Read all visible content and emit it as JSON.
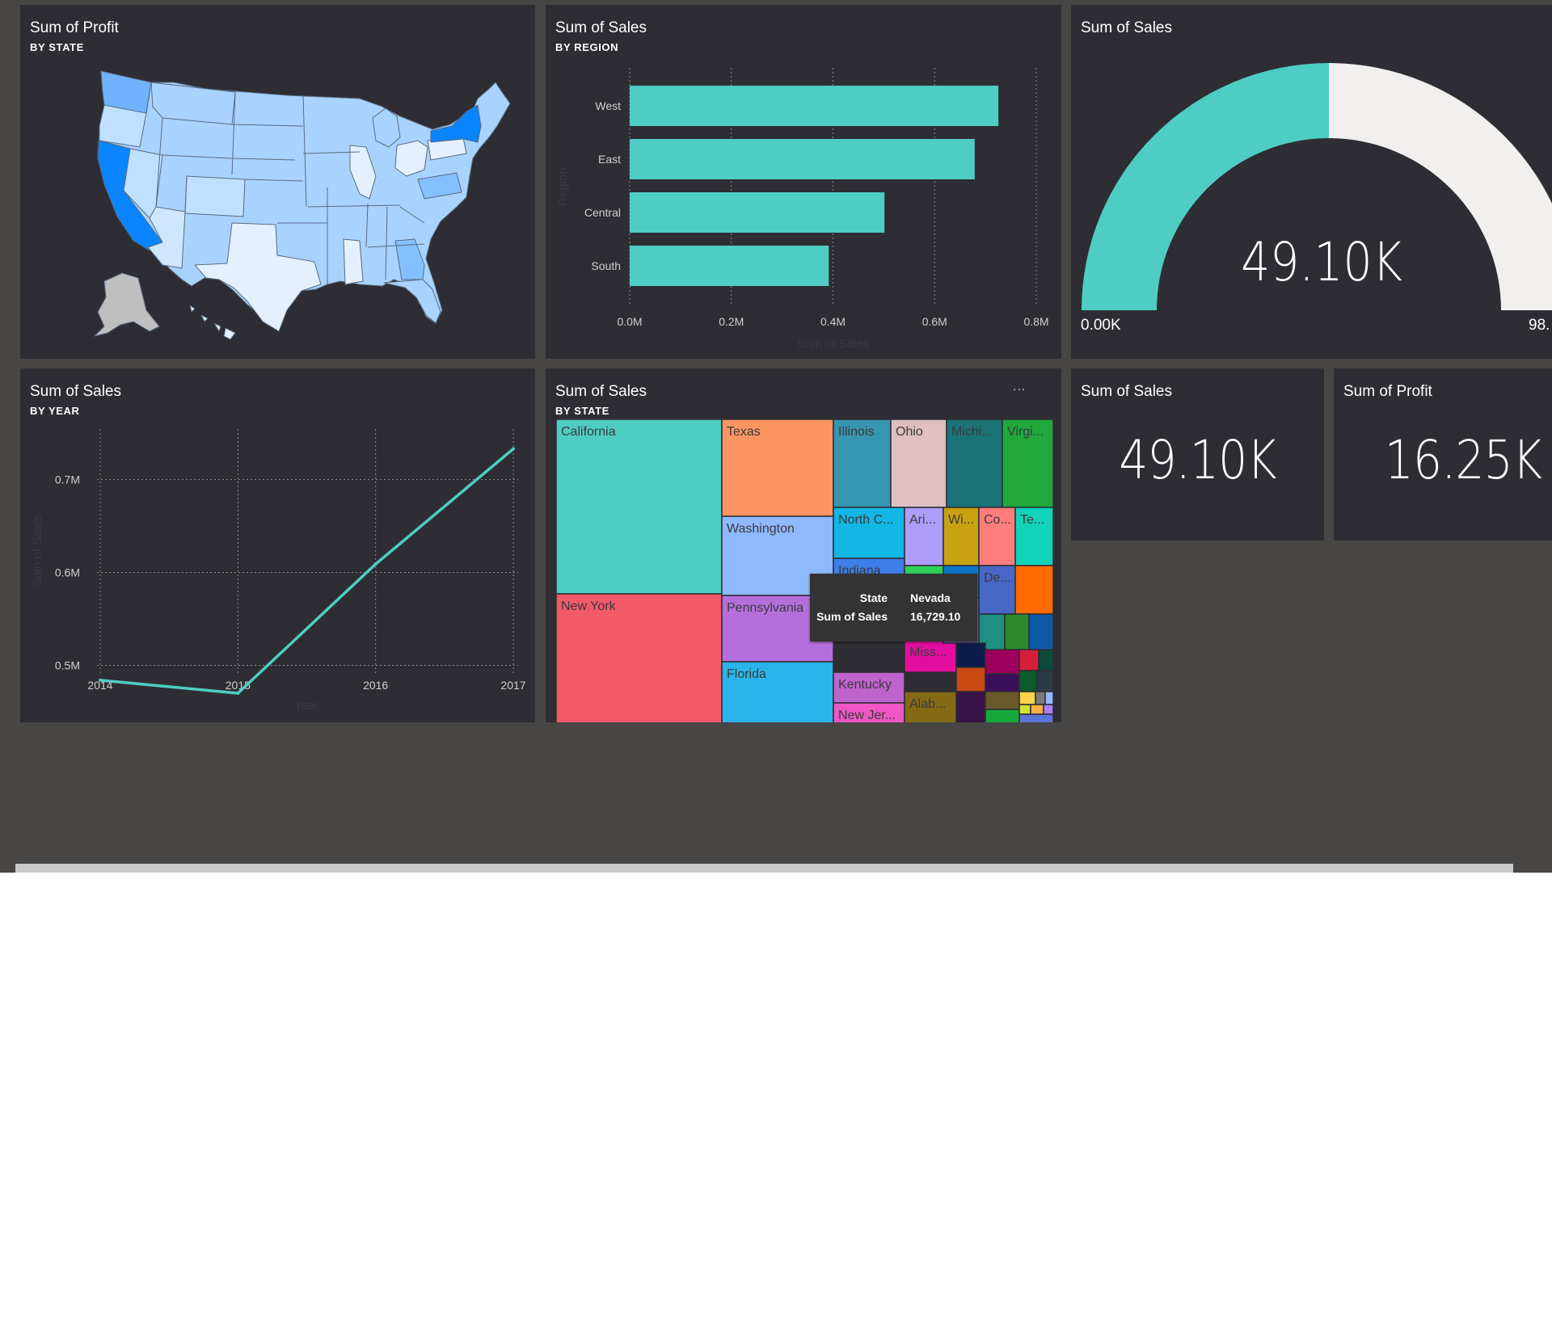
{
  "colors": {
    "accent": "#4ecdc4",
    "tile_bg": "#2e2d33",
    "canvas_bg": "#474645",
    "gauge_track": "#f1f0ee",
    "map_light": "#e4f0fd",
    "map_mid": "#a9d3ff",
    "map_dark": "#0a84ff",
    "map_alaska": "#bfbfbf"
  },
  "tiles": {
    "map": {
      "title": "Sum of Profit",
      "subtitle": "BY STATE"
    },
    "bar": {
      "title": "Sum of Sales",
      "subtitle": "BY REGION"
    },
    "gauge": {
      "title": "Sum of Sales",
      "value": "49.10K",
      "min_label": "0.00K",
      "max_label": "98.",
      "fill_fraction": 0.5
    },
    "line": {
      "title": "Sum of Sales",
      "subtitle": "BY YEAR"
    },
    "treemap": {
      "title": "Sum of Sales",
      "subtitle": "BY STATE",
      "menu_icon": "ellipsis-icon",
      "menu_label": "..."
    },
    "card_sales": {
      "title": "Sum of Sales",
      "value": "49.10K"
    },
    "card_profit": {
      "title": "Sum of Profit",
      "value": "16.25K"
    }
  },
  "tooltip": {
    "rows": [
      {
        "key": "State",
        "value": "Nevada"
      },
      {
        "key": "Sum of Sales",
        "value": "16,729.10"
      }
    ]
  },
  "chart_data": [
    {
      "type": "bar",
      "orientation": "horizontal",
      "title": "Sum of Sales",
      "subtitle": "BY REGION",
      "categories": [
        "West",
        "East",
        "Central",
        "South"
      ],
      "values": [
        725457,
        678781,
        501240,
        391722
      ],
      "xlabel": "Sum of Sales",
      "ylabel": "Region",
      "xlim": [
        0,
        800000
      ],
      "ticks": [
        0,
        200000,
        400000,
        600000,
        800000
      ],
      "tick_labels": [
        "0.0M",
        "0.2M",
        "0.4M",
        "0.6M",
        "0.8M"
      ],
      "grid": true
    },
    {
      "type": "line",
      "title": "Sum of Sales",
      "subtitle": "BY YEAR",
      "x": [
        "2014",
        "2015",
        "2016",
        "2017"
      ],
      "values": [
        484000,
        470000,
        609000,
        733000
      ],
      "xlabel": "Year",
      "ylabel": "Sum of Sales",
      "ylim": [
        0.45,
        0.75
      ],
      "yticks": [
        0.5,
        0.6,
        0.7
      ],
      "ytick_labels": [
        "0.5M",
        "0.6M",
        "0.7M"
      ],
      "grid": true
    },
    {
      "type": "treemap",
      "title": "Sum of Sales",
      "subtitle": "BY STATE",
      "labels": [
        "California",
        "New York",
        "Texas",
        "Washington",
        "Pennsylvania",
        "Florida",
        "Illinois",
        "Ohio",
        "Michi...",
        "Virgi...",
        "North C...",
        "Ari...",
        "Wi...",
        "Co...",
        "Te...",
        "Indiana",
        "Kentucky",
        "New Jer...",
        "Miss...",
        "Alab...",
        "De..."
      ],
      "colors": [
        "#4ecdc4",
        "#f25a68",
        "#fd9563",
        "#8fb9ff",
        "#b56fdc",
        "#2ab4ea",
        "#3695b0",
        "#dfbfc2",
        "#197377",
        "#20a83c",
        "#12b7e6",
        "#ad9df8",
        "#c8a210",
        "#ff7d7d",
        "#11d3ba",
        "#3e7ee8",
        "#bf63cc",
        "#ee57c5",
        "#e30ea0",
        "#846a14",
        "#4768c7"
      ]
    }
  ]
}
